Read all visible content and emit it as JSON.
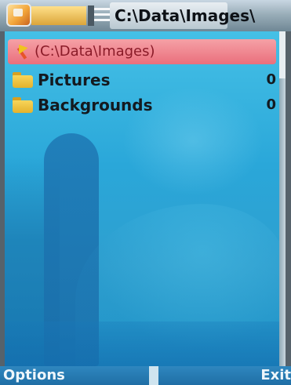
{
  "titlebar": {
    "path": "C:\\Data\\Images\\"
  },
  "list": {
    "parent": {
      "label": "(C:\\Data\\Images)"
    },
    "items": [
      {
        "label": "Pictures",
        "count": "0"
      },
      {
        "label": "Backgrounds",
        "count": "0"
      }
    ]
  },
  "softkeys": {
    "left": "Options",
    "right": "Exit"
  },
  "colors": {
    "highlight": "#ea6f7c",
    "background": "#2aa7d9",
    "softkey_bar": "#1f6ea5"
  },
  "icons": {
    "app": "file-manager-icon",
    "folder": "folder-icon",
    "up": "up-arrow-icon"
  }
}
